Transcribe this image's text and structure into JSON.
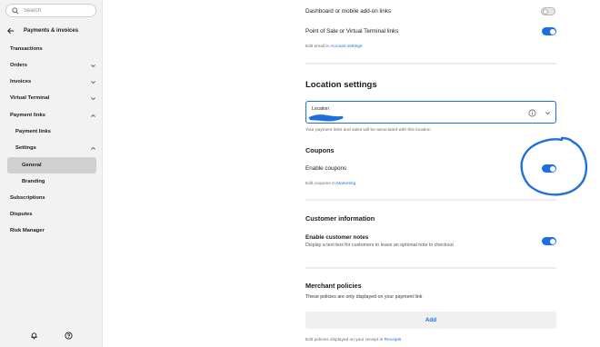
{
  "sidebar": {
    "search_placeholder": "Search",
    "back_title": "Payments & invoices",
    "items": [
      {
        "label": "Transactions"
      },
      {
        "label": "Orders"
      },
      {
        "label": "Invoices"
      },
      {
        "label": "Virtual Terminal"
      },
      {
        "label": "Payment links"
      },
      {
        "label": "Payment links"
      },
      {
        "label": "Settings"
      },
      {
        "label": "General"
      },
      {
        "label": "Branding"
      },
      {
        "label": "Subscriptions"
      },
      {
        "label": "Disputes"
      },
      {
        "label": "Risk Manager"
      }
    ]
  },
  "main": {
    "dashboard_links_label": "Dashboard or mobile add-on links",
    "dashboard_links_on": false,
    "pos_links_label": "Point of Sale or Virtual Terminal links",
    "pos_links_on": true,
    "edit_email_prefix": "Edit email in ",
    "edit_email_link": "Account settings",
    "location_settings_title": "Location settings",
    "location_field_label": "Location",
    "location_help": "Your payment links and sales will be associated with this location",
    "coupons_title": "Coupons",
    "enable_coupons_label": "Enable coupons",
    "enable_coupons_on": true,
    "edit_coupons_prefix": "Edit coupons in ",
    "edit_coupons_link": "Marketing",
    "customer_info_title": "Customer information",
    "enable_notes_label": "Enable customer notes",
    "enable_notes_desc": "Display a text box for customers to leave an optional note in checkout",
    "enable_notes_on": true,
    "merchant_policies_title": "Merchant policies",
    "merchant_policies_desc": "These policies are only displayed on your payment link",
    "add_button_label": "Add",
    "edit_policies_prefix": "Edit policies displayed on your receipt in ",
    "edit_policies_link": "Receipts"
  },
  "colors": {
    "accent": "#1f6fde",
    "sidebar_bg": "#f2f2f2",
    "active_item_bg": "#d0d0d0",
    "annotation": "#1f6fde"
  },
  "icons": [
    "search-icon",
    "back-arrow-icon",
    "chevron-down-icon",
    "chevron-up-icon",
    "info-icon",
    "bell-icon",
    "help-icon"
  ]
}
